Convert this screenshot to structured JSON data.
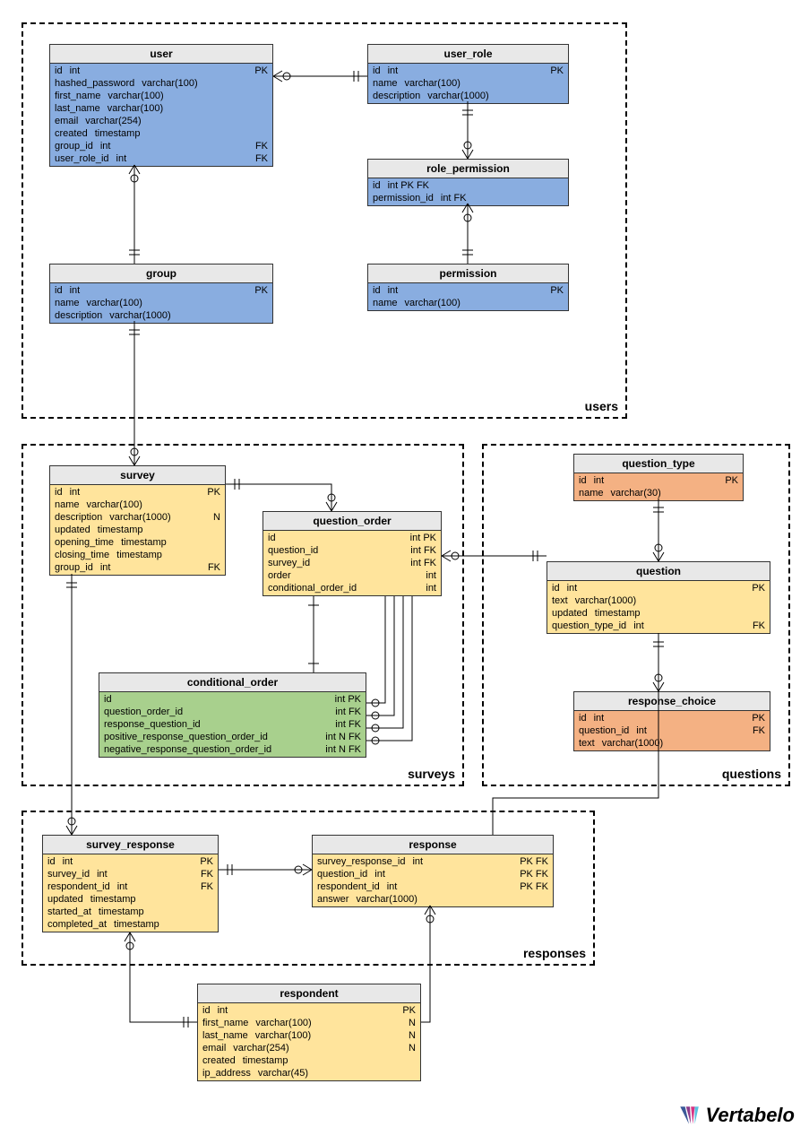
{
  "logo_text": "Vertabelo",
  "groups": {
    "users": {
      "label": "users"
    },
    "surveys": {
      "label": "surveys"
    },
    "questions": {
      "label": "questions"
    },
    "responses": {
      "label": "responses"
    }
  },
  "tables": {
    "user": {
      "title": "user",
      "rows": [
        {
          "name": "id",
          "type": "int",
          "key": "PK"
        },
        {
          "name": "hashed_password",
          "type": "varchar(100)",
          "key": ""
        },
        {
          "name": "first_name",
          "type": "varchar(100)",
          "key": ""
        },
        {
          "name": "last_name",
          "type": "varchar(100)",
          "key": ""
        },
        {
          "name": "email",
          "type": "varchar(254)",
          "key": ""
        },
        {
          "name": "created",
          "type": "timestamp",
          "key": ""
        },
        {
          "name": "group_id",
          "type": "int",
          "key": "FK"
        },
        {
          "name": "user_role_id",
          "type": "int",
          "key": "FK"
        }
      ]
    },
    "user_role": {
      "title": "user_role",
      "rows": [
        {
          "name": "id",
          "type": "int",
          "key": "PK"
        },
        {
          "name": "name",
          "type": "varchar(100)",
          "key": ""
        },
        {
          "name": "description",
          "type": "varchar(1000)",
          "key": ""
        }
      ]
    },
    "role_permission": {
      "title": "role_permission",
      "rows": [
        {
          "name": "id",
          "type": "int PK FK",
          "key": ""
        },
        {
          "name": "permission_id",
          "type": "int FK",
          "key": ""
        }
      ]
    },
    "permission": {
      "title": "permission",
      "rows": [
        {
          "name": "id",
          "type": "int",
          "key": "PK"
        },
        {
          "name": "name",
          "type": "varchar(100)",
          "key": ""
        }
      ]
    },
    "group": {
      "title": "group",
      "rows": [
        {
          "name": "id",
          "type": "int",
          "key": "PK"
        },
        {
          "name": "name",
          "type": "varchar(100)",
          "key": ""
        },
        {
          "name": "description",
          "type": "varchar(1000)",
          "key": ""
        }
      ]
    },
    "survey": {
      "title": "survey",
      "rows": [
        {
          "name": "id",
          "type": "int",
          "key": "PK"
        },
        {
          "name": "name",
          "type": "varchar(100)",
          "key": ""
        },
        {
          "name": "description",
          "type": "varchar(1000)",
          "key": "N"
        },
        {
          "name": "updated",
          "type": "timestamp",
          "key": ""
        },
        {
          "name": "opening_time",
          "type": "timestamp",
          "key": ""
        },
        {
          "name": "closing_time",
          "type": "timestamp",
          "key": ""
        },
        {
          "name": "group_id",
          "type": "int",
          "key": "FK"
        }
      ]
    },
    "question_order": {
      "title": "question_order",
      "rows": [
        {
          "name": "id",
          "type": "",
          "key": "int PK"
        },
        {
          "name": "question_id",
          "type": "",
          "key": "int FK"
        },
        {
          "name": "survey_id",
          "type": "",
          "key": "int FK"
        },
        {
          "name": "order",
          "type": "",
          "key": "int"
        },
        {
          "name": "conditional_order_id",
          "type": "",
          "key": "int"
        }
      ]
    },
    "conditional_order": {
      "title": "conditional_order",
      "rows": [
        {
          "name": "id",
          "type": "",
          "key": "int PK"
        },
        {
          "name": "question_order_id",
          "type": "",
          "key": "int FK"
        },
        {
          "name": "response_question_id",
          "type": "",
          "key": "int FK"
        },
        {
          "name": "positive_response_question_order_id",
          "type": "",
          "key": "int N FK"
        },
        {
          "name": "negative_response_question_order_id",
          "type": "",
          "key": "int N FK"
        }
      ]
    },
    "question_type": {
      "title": "question_type",
      "rows": [
        {
          "name": "id",
          "type": "int",
          "key": "PK"
        },
        {
          "name": "name",
          "type": "varchar(30)",
          "key": ""
        }
      ]
    },
    "question": {
      "title": "question",
      "rows": [
        {
          "name": "id",
          "type": "int",
          "key": "PK"
        },
        {
          "name": "text",
          "type": "varchar(1000)",
          "key": ""
        },
        {
          "name": "updated",
          "type": "timestamp",
          "key": ""
        },
        {
          "name": "question_type_id",
          "type": "int",
          "key": "FK"
        }
      ]
    },
    "response_choice": {
      "title": "response_choice",
      "rows": [
        {
          "name": "id",
          "type": "int",
          "key": "PK"
        },
        {
          "name": "question_id",
          "type": "int",
          "key": "FK"
        },
        {
          "name": "text",
          "type": "varchar(1000)",
          "key": ""
        }
      ]
    },
    "survey_response": {
      "title": "survey_response",
      "rows": [
        {
          "name": "id",
          "type": "int",
          "key": "PK"
        },
        {
          "name": "survey_id",
          "type": "int",
          "key": "FK"
        },
        {
          "name": "respondent_id",
          "type": "int",
          "key": "FK"
        },
        {
          "name": "updated",
          "type": "timestamp",
          "key": ""
        },
        {
          "name": "started_at",
          "type": "timestamp",
          "key": ""
        },
        {
          "name": "completed_at",
          "type": "timestamp",
          "key": ""
        }
      ]
    },
    "response": {
      "title": "response",
      "rows": [
        {
          "name": "survey_response_id",
          "type": "int",
          "key": "PK FK"
        },
        {
          "name": "question_id",
          "type": "int",
          "key": "PK FK"
        },
        {
          "name": "respondent_id",
          "type": "int",
          "key": "PK FK"
        },
        {
          "name": "answer",
          "type": "varchar(1000)",
          "key": ""
        }
      ]
    },
    "respondent": {
      "title": "respondent",
      "rows": [
        {
          "name": "id",
          "type": "int",
          "key": "PK"
        },
        {
          "name": "first_name",
          "type": "varchar(100)",
          "key": "N"
        },
        {
          "name": "last_name",
          "type": "varchar(100)",
          "key": "N"
        },
        {
          "name": "email",
          "type": "varchar(254)",
          "key": "N"
        },
        {
          "name": "created",
          "type": "timestamp",
          "key": ""
        },
        {
          "name": "ip_address",
          "type": "varchar(45)",
          "key": ""
        }
      ]
    }
  },
  "relationships": [
    {
      "from": "user.user_role_id",
      "to": "user_role.id",
      "type": "many-to-one"
    },
    {
      "from": "user.group_id",
      "to": "group.id",
      "type": "many-to-one"
    },
    {
      "from": "role_permission.id",
      "to": "user_role.id",
      "type": "many-to-one"
    },
    {
      "from": "role_permission.permission_id",
      "to": "permission.id",
      "type": "many-to-one"
    },
    {
      "from": "survey.group_id",
      "to": "group.id",
      "type": "many-to-one"
    },
    {
      "from": "question_order.survey_id",
      "to": "survey.id",
      "type": "many-to-one"
    },
    {
      "from": "question_order.question_id",
      "to": "question.id",
      "type": "many-to-one"
    },
    {
      "from": "question_order.conditional_order_id",
      "to": "conditional_order.id",
      "type": "one-to-one"
    },
    {
      "from": "conditional_order.question_order_id",
      "to": "question_order.id",
      "type": "many-to-one"
    },
    {
      "from": "conditional_order.response_question_id",
      "to": "question_order.id",
      "type": "many-to-one"
    },
    {
      "from": "conditional_order.positive_response_question_order_id",
      "to": "question_order.id",
      "type": "many-to-one"
    },
    {
      "from": "conditional_order.negative_response_question_order_id",
      "to": "question_order.id",
      "type": "many-to-one"
    },
    {
      "from": "question.question_type_id",
      "to": "question_type.id",
      "type": "many-to-one"
    },
    {
      "from": "response_choice.question_id",
      "to": "question.id",
      "type": "many-to-one"
    },
    {
      "from": "survey_response.survey_id",
      "to": "survey.id",
      "type": "many-to-one"
    },
    {
      "from": "survey_response.respondent_id",
      "to": "respondent.id",
      "type": "many-to-one"
    },
    {
      "from": "response.survey_response_id",
      "to": "survey_response.id",
      "type": "many-to-one"
    },
    {
      "from": "response.question_id",
      "to": "question.id",
      "type": "many-to-one"
    },
    {
      "from": "response.respondent_id",
      "to": "respondent.id",
      "type": "many-to-one"
    }
  ]
}
